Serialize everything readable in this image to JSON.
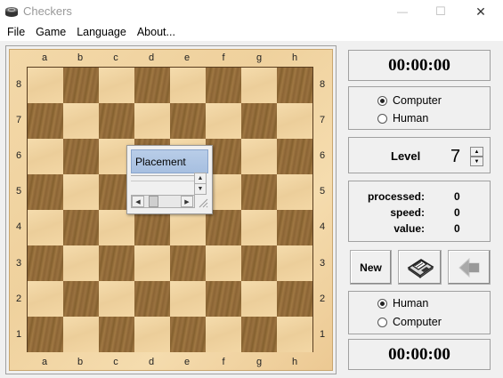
{
  "window": {
    "title": "Checkers",
    "minimize_glyph": "—",
    "maximize_glyph": "☐",
    "close_glyph": "✕"
  },
  "menu": {
    "items": [
      {
        "label": "File"
      },
      {
        "label": "Game"
      },
      {
        "label": "Language"
      },
      {
        "label": "About..."
      }
    ]
  },
  "board": {
    "files": [
      "a",
      "b",
      "c",
      "d",
      "e",
      "f",
      "g",
      "h"
    ],
    "ranks": [
      "8",
      "7",
      "6",
      "5",
      "4",
      "3",
      "2",
      "1"
    ],
    "light_color": "#f1d6a6",
    "dark_color": "#916a39"
  },
  "placement_dialog": {
    "title": "Placement"
  },
  "top_player": {
    "clock": "00:00:00",
    "options": [
      {
        "label": "Computer",
        "selected": true
      },
      {
        "label": "Human",
        "selected": false
      }
    ]
  },
  "level": {
    "label": "Level",
    "value": "7"
  },
  "stats": {
    "processed_label": "processed:",
    "processed_value": "0",
    "speed_label": "speed:",
    "speed_value": "0",
    "value_label": "value:",
    "value_value": "0"
  },
  "actions": {
    "new_label": "New",
    "save_icon": "floppy-disk-icon",
    "undo_icon": "arrow-left-icon"
  },
  "bottom_player": {
    "clock": "00:00:00",
    "options": [
      {
        "label": "Human",
        "selected": true
      },
      {
        "label": "Computer",
        "selected": false
      }
    ]
  }
}
